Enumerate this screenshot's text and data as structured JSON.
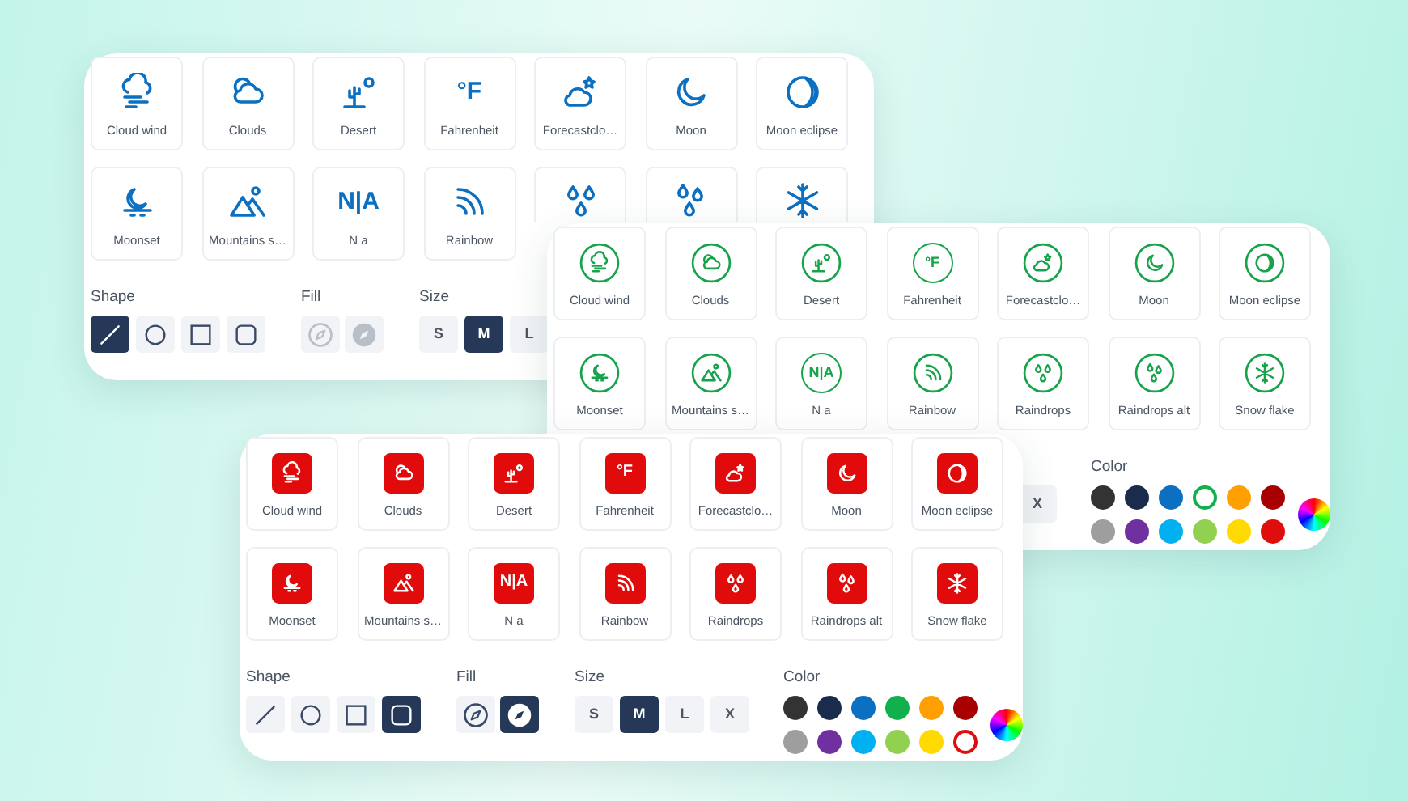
{
  "cards": [
    {
      "kind": "outline",
      "color": "#0b6fc2",
      "tiles": [
        {
          "kind": "full",
          "label": "Cloud wind"
        },
        {
          "kind": "full",
          "label": "Clouds"
        },
        {
          "kind": "full",
          "label": "Desert"
        },
        {
          "kind": "full",
          "label": "Fahrenheit",
          "glyph": "°F"
        },
        {
          "kind": "full",
          "label": "Forecastclo…"
        },
        {
          "kind": "full",
          "label": "Moon"
        },
        {
          "kind": "full",
          "label": "Moon eclipse"
        },
        {
          "kind": "full",
          "label": "Moonset"
        },
        {
          "kind": "full",
          "label": "Mountains s…"
        },
        {
          "kind": "full",
          "label": "N a",
          "glyph": "N|A"
        },
        {
          "kind": "full",
          "label": "Rainbow"
        },
        {
          "kind": "cut"
        },
        {
          "kind": "cut"
        },
        {
          "kind": "cut"
        }
      ],
      "shape": {
        "label": "Shape",
        "options": [
          {
            "selected": true
          },
          {
            "selected": false
          },
          {
            "selected": false
          },
          {
            "selected": false
          }
        ]
      },
      "fill": {
        "label": "Fill",
        "disabled": true,
        "options": [
          {
            "selected": false
          },
          {
            "selected": false
          }
        ]
      },
      "size": {
        "label": "Size",
        "options": [
          {
            "label": "S",
            "selected": false
          },
          {
            "label": "M",
            "selected": true
          },
          {
            "label": "L",
            "selected": false
          }
        ]
      }
    },
    {
      "kind": "circle",
      "color": "#16a34a",
      "tiles": [
        {
          "label": "Cloud wind"
        },
        {
          "label": "Clouds"
        },
        {
          "label": "Desert"
        },
        {
          "label": "Fahrenheit",
          "glyph": "°F"
        },
        {
          "label": "Forecastclo…"
        },
        {
          "label": "Moon"
        },
        {
          "label": "Moon eclipse"
        },
        {
          "label": "Moonset"
        },
        {
          "label": "Mountains s…"
        },
        {
          "label": "N a",
          "glyph": "N|A"
        },
        {
          "label": "Rainbow"
        },
        {
          "label": "Raindrops"
        },
        {
          "label": "Raindrops alt"
        },
        {
          "label": "Snow flake"
        }
      ],
      "size": {
        "options": [
          {
            "label": "X",
            "selected": false
          }
        ]
      },
      "palette": {
        "label": "Color",
        "swatches": [
          {
            "color": "#333333",
            "selected": false
          },
          {
            "color": "#1a2b4c",
            "selected": false
          },
          {
            "color": "#0b6fc2",
            "selected": false
          },
          {
            "color": "#10b04c",
            "selected": true
          },
          {
            "color": "#ff9f00",
            "selected": false
          },
          {
            "color": "#a80000",
            "selected": false
          },
          {
            "color": "#9e9e9e",
            "selected": false
          },
          {
            "color": "#7030a0",
            "selected": false
          },
          {
            "color": "#00b0f0",
            "selected": false
          },
          {
            "color": "#92d050",
            "selected": false
          },
          {
            "color": "#ffd900",
            "selected": false
          },
          {
            "color": "#e00d0d",
            "selected": false
          }
        ]
      }
    },
    {
      "kind": "filled",
      "color": "#e20b0b",
      "tiles": [
        {
          "label": "Cloud wind"
        },
        {
          "label": "Clouds"
        },
        {
          "label": "Desert"
        },
        {
          "label": "Fahrenheit",
          "glyph": "°F"
        },
        {
          "label": "Forecastclo…"
        },
        {
          "label": "Moon"
        },
        {
          "label": "Moon eclipse"
        },
        {
          "label": "Moonset"
        },
        {
          "label": "Mountains s…"
        },
        {
          "label": "N a",
          "glyph": "N|A"
        },
        {
          "label": "Rainbow"
        },
        {
          "label": "Raindrops"
        },
        {
          "label": "Raindrops alt"
        },
        {
          "label": "Snow flake"
        }
      ],
      "shape": {
        "label": "Shape",
        "options": [
          {
            "selected": false
          },
          {
            "selected": false
          },
          {
            "selected": false
          },
          {
            "selected": true
          }
        ]
      },
      "fill": {
        "label": "Fill",
        "disabled": false,
        "options": [
          {
            "selected": false
          },
          {
            "selected": true
          }
        ]
      },
      "size": {
        "label": "Size",
        "options": [
          {
            "label": "S",
            "selected": false
          },
          {
            "label": "M",
            "selected": true
          },
          {
            "label": "L",
            "selected": false
          },
          {
            "label": "X",
            "selected": false
          }
        ]
      },
      "palette": {
        "label": "Color",
        "swatches": [
          {
            "color": "#333333",
            "selected": false
          },
          {
            "color": "#1a2b4c",
            "selected": false
          },
          {
            "color": "#0b6fc2",
            "selected": false
          },
          {
            "color": "#10b04c",
            "selected": false
          },
          {
            "color": "#ff9f00",
            "selected": false
          },
          {
            "color": "#a80000",
            "selected": false
          },
          {
            "color": "#9e9e9e",
            "selected": false
          },
          {
            "color": "#7030a0",
            "selected": false
          },
          {
            "color": "#00b0f0",
            "selected": false
          },
          {
            "color": "#92d050",
            "selected": false
          },
          {
            "color": "#ffd900",
            "selected": false
          },
          {
            "color": "#e00d0d",
            "selected": true
          }
        ]
      }
    }
  ]
}
